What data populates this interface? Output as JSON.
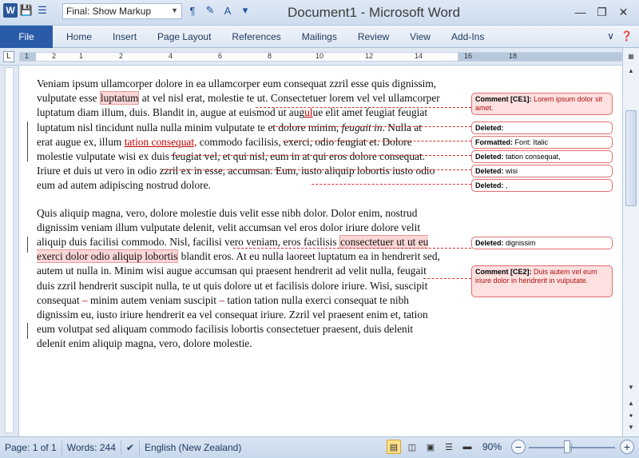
{
  "app": {
    "title": "Document1 - Microsoft Word"
  },
  "quick_access": {
    "markup_mode": "Final: Show Markup"
  },
  "ribbon": {
    "file_tab": "File",
    "tabs": [
      "Home",
      "Insert",
      "Page Layout",
      "References",
      "Mailings",
      "Review",
      "View",
      "Add-Ins"
    ]
  },
  "ruler": {
    "numbers": [
      "1",
      "2",
      "1",
      "2",
      "4",
      "6",
      "8",
      "10",
      "12",
      "14",
      "16",
      "18"
    ]
  },
  "document": {
    "p1": {
      "a": "Veniam ipsum ullamcorper dolore in ea ullamcorper eum consequat zzril esse quis dignissim, vulputate esse ",
      "comment_text": "luptatum",
      "b": " at vel nisl erat, molestie te ut. Consectetuer lorem vel vel ullamcorper luptatum diam illum, duis. Blandit in, augue at euismod ut aug",
      "ins1": "ul",
      "c": "ue elit amet feugiat feugiat luptatum nisl tincidunt nulla nulla minim vulputate te et dolore minim, ",
      "italic": "feugait in",
      "d": ". Nulla at erat augue ex, illum ",
      "ins2": "tation consequat,",
      "e": " commodo facilisis, exerci, odio feugiat et. Dolore molestie vulputate wisi ex duis feugiat vel, et qui nisl, eum in at qui eros dolore consequat. Iriure et duis ut vero in odio zzril ex in esse, accumsan. Eum, iusto aliquip lobortis iusto odio eum ad autem adipiscing nostrud dolore."
    },
    "p2": {
      "a": "Quis aliquip magna, vero, dolore molestie duis velit esse nibh dolor. Dolor enim, nostrud dignissim veniam illum vulputate delenit, velit accumsan vel eros dolor iriure dolore velit aliquip duis facilisi commodo. Nisl, facilisi vero veniam, eros facilisis ",
      "comment_text": "consectetuer ut ut eu exerci dolor odio aliquip lobortis",
      "b": " blandit eros. At eu nulla laoreet luptatum ea in hendrerit sed, autem ut nulla in. Minim wisi augue accumsan qui praesent hendrerit ad velit nulla, feugait duis zzril hendrerit suscipit nulla, te ut quis dolore ut et facilisis dolore iriure. Wisi, suscipit consequat ",
      "dash1": "–",
      "c": " minim autem veniam suscipit ",
      "dash2": "–",
      "d": " tation tation nulla exerci consequat te nibh dignissim eu, iusto iriure hendrerit ea vel consequat iriure. Zzril vel praesent enim et, tation eum volutpat sed aliquam commodo facilisis lobortis consectetuer praesent, duis delenit delenit enim aliquip magna, vero, dolore molestie."
    }
  },
  "balloons": [
    {
      "label": "Comment [CE1]:",
      "text": "Lorem ipsum dolor sit amet."
    },
    {
      "label": "Deleted:",
      "text": ""
    },
    {
      "label": "Formatted:",
      "text": "Font: Italic"
    },
    {
      "label": "Deleted:",
      "text": "tation consequat,"
    },
    {
      "label": "Deleted:",
      "text": "wisi"
    },
    {
      "label": "Deleted:",
      "text": ","
    },
    {
      "label": "Deleted:",
      "text": "dignissim"
    },
    {
      "label": "Comment [CE2]:",
      "text": "Duis autem vel eum iriure dolor in hendrerit in vulputate."
    }
  ],
  "status": {
    "page": "Page: 1 of 1",
    "words": "Words: 244",
    "language": "English (New Zealand)",
    "zoom": "90%"
  },
  "colors": {
    "accent": "#2a5ba8",
    "markup": "#c00000",
    "balloon_border": "#e26f6f"
  }
}
